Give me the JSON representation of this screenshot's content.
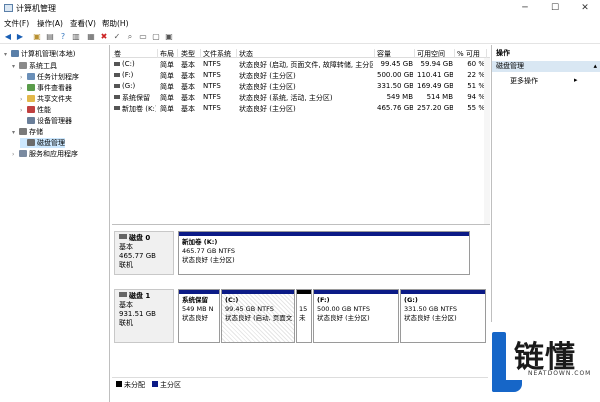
{
  "window": {
    "title": "计算机管理"
  },
  "menu": [
    "文件(F)",
    "操作(A)",
    "查看(V)",
    "帮助(H)"
  ],
  "tree": [
    {
      "label": "计算机管理(本地)",
      "level": 0,
      "expander": "▾",
      "icon": "computer-icon",
      "color": "#5a7fa8"
    },
    {
      "label": "系统工具",
      "level": 1,
      "expander": "▾",
      "icon": "tools-icon",
      "color": "#8a8a8a"
    },
    {
      "label": "任务计划程序",
      "level": 2,
      "expander": "›",
      "icon": "clock-icon",
      "color": "#6a8fb8"
    },
    {
      "label": "事件查看器",
      "level": 2,
      "expander": "›",
      "icon": "event-icon",
      "color": "#5a9c4a"
    },
    {
      "label": "共享文件夹",
      "level": 2,
      "expander": "›",
      "icon": "folder-icon",
      "color": "#e2b84a"
    },
    {
      "label": "性能",
      "level": 2,
      "expander": "›",
      "icon": "performance-icon",
      "color": "#c04040"
    },
    {
      "label": "设备管理器",
      "level": 2,
      "expander": "",
      "icon": "device-icon",
      "color": "#6a7f9a"
    },
    {
      "label": "存储",
      "level": 1,
      "expander": "▾",
      "icon": "storage-icon",
      "color": "#7a7a7a"
    },
    {
      "label": "磁盘管理",
      "level": 2,
      "expander": "",
      "icon": "disk-icon",
      "color": "#6a6a6a",
      "selected": true
    },
    {
      "label": "服务和应用程序",
      "level": 1,
      "expander": "›",
      "icon": "services-icon",
      "color": "#7a8aa0"
    }
  ],
  "table": {
    "headers": [
      "卷",
      "布局",
      "类型",
      "文件系统",
      "状态",
      "容量",
      "可用空间",
      "% 可用"
    ],
    "rows": [
      [
        "(C:)",
        "简单",
        "基本",
        "NTFS",
        "状态良好 (启动, 页面文件, 故障转储, 主分区)",
        "99.45 GB",
        "59.94 GB",
        "60 %"
      ],
      [
        "(F:)",
        "简单",
        "基本",
        "NTFS",
        "状态良好 (主分区)",
        "500.00 GB",
        "110.41 GB",
        "22 %"
      ],
      [
        "(G:)",
        "简单",
        "基本",
        "NTFS",
        "状态良好 (主分区)",
        "331.50 GB",
        "169.49 GB",
        "51 %"
      ],
      [
        "系统保留",
        "简单",
        "基本",
        "NTFS",
        "状态良好 (系统, 活动, 主分区)",
        "549 MB",
        "514 MB",
        "94 %"
      ],
      [
        "新加卷 (K:)",
        "简单",
        "基本",
        "NTFS",
        "状态良好 (主分区)",
        "465.76 GB",
        "257.20 GB",
        "55 %"
      ]
    ]
  },
  "disks": [
    {
      "name": "磁盘 0",
      "type": "基本",
      "size": "465.77 GB",
      "status": "联机",
      "partitions": [
        {
          "name": "新加卷 (K:)",
          "size": "465.77 GB NTFS",
          "status": "状态良好 (主分区)"
        }
      ]
    },
    {
      "name": "磁盘 1",
      "type": "基本",
      "size": "931.51 GB",
      "status": "联机",
      "partitions": [
        {
          "name": "系统保留",
          "size": "549 MB N",
          "status": "状态良好"
        },
        {
          "name": "(C:)",
          "size": "99.45 GB NTFS",
          "status": "状态良好 (启动, 页面文"
        },
        {
          "name": "",
          "size": "15",
          "status": "未"
        },
        {
          "name": "(F:)",
          "size": "500.00 GB NTFS",
          "status": "状态良好 (主分区)"
        },
        {
          "name": "(G:)",
          "size": "331.50 GB NTFS",
          "status": "状态良好 (主分区)"
        }
      ]
    }
  ],
  "legend": [
    {
      "label": "未分配",
      "color": "#000000"
    },
    {
      "label": "主分区",
      "color": "#0b1a86"
    }
  ],
  "actions": {
    "header": "操作",
    "section": "磁盘管理",
    "more": "更多操作",
    "more_arrow": "▸"
  },
  "watermark": {
    "word": "链懂",
    "url": "NEATDOWN.COM"
  },
  "colors": {
    "accent": "#1666c8",
    "primary_partition": "#0b1a86",
    "selection": "#cce8ff"
  }
}
